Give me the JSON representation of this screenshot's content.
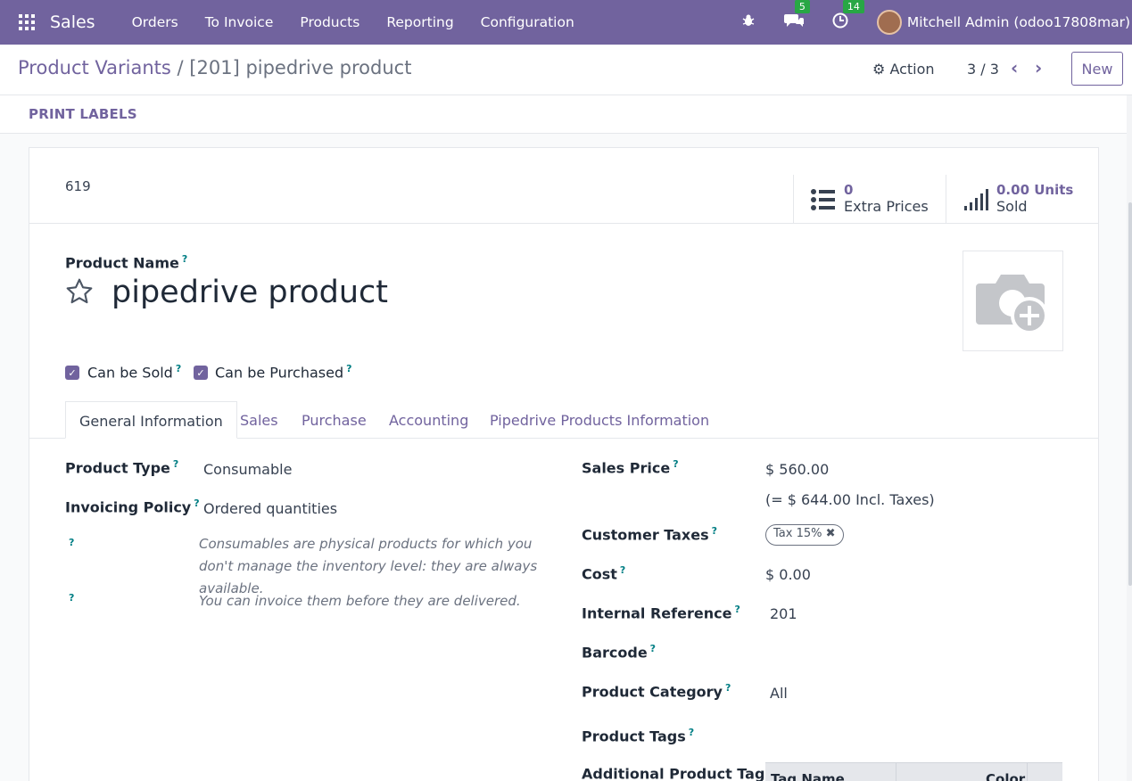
{
  "topbar": {
    "app_name": "Sales",
    "nav": [
      "Orders",
      "To Invoice",
      "Products",
      "Reporting",
      "Configuration"
    ],
    "messages_count": "5",
    "activities_count": "14",
    "user": "Mitchell Admin (odoo17808mar)",
    "colors": {
      "brand": "#71639e",
      "badge": "#28a745"
    }
  },
  "controlbar": {
    "breadcrumb_parent": "Product Variants",
    "breadcrumb_sep": "/",
    "breadcrumb_current": "[201] pipedrive product",
    "action_label": "Action",
    "pager": "3 / 3",
    "new_label": "New"
  },
  "statusbar": {
    "print_labels": "PRINT LABELS"
  },
  "record": {
    "id": "619",
    "stats": [
      {
        "value": "0",
        "label": "Extra Prices",
        "icon": "list-icon"
      },
      {
        "value": "0.00 Units",
        "label": "Sold",
        "icon": "signal-bars-icon"
      }
    ],
    "product_name_label": "Product Name",
    "product_name": "pipedrive product",
    "can_be_sold_label": "Can be Sold",
    "can_be_purchased_label": "Can be Purchased",
    "can_be_sold": true,
    "can_be_purchased": true
  },
  "tabs": [
    "General Information",
    "Sales",
    "Purchase",
    "Accounting",
    "Pipedrive Products Information"
  ],
  "general": {
    "product_type_label": "Product Type",
    "product_type": "Consumable",
    "invoicing_policy_label": "Invoicing Policy",
    "invoicing_policy": "Ordered quantities",
    "help_consumable": "Consumables are physical products for which you don't manage the inventory level: they are always available.",
    "help_invoice": "You can invoice them before they are delivered.",
    "sales_price_label": "Sales Price",
    "sales_price": "$ 560.00",
    "sales_price_incl": "(= $ 644.00 Incl. Taxes)",
    "customer_taxes_label": "Customer Taxes",
    "tax_tag": "Tax 15%",
    "cost_label": "Cost",
    "cost": "$ 0.00",
    "internal_ref_label": "Internal Reference",
    "internal_ref": "201",
    "barcode_label": "Barcode",
    "category_label": "Product Category",
    "category": "All",
    "tags_label": "Product Tags",
    "additional_tag_label": "Additional Product Tag",
    "tag_table_headers": [
      "Tag Name",
      "Color"
    ]
  },
  "help_mark": "?"
}
